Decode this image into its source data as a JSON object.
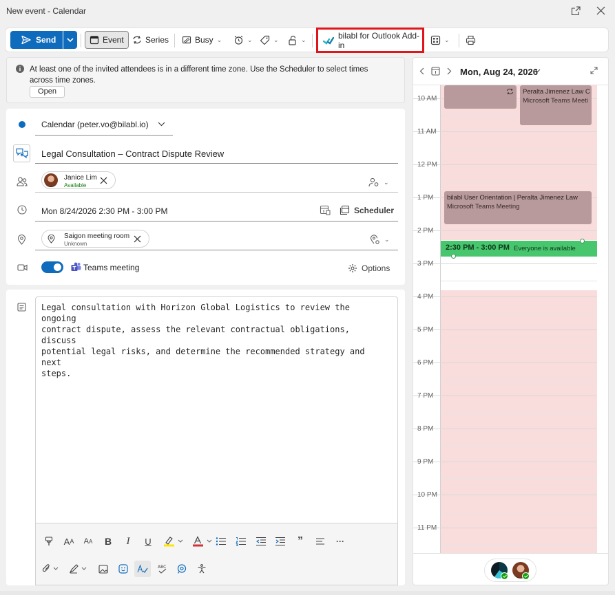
{
  "window": {
    "title": "New event - Calendar"
  },
  "toolbar": {
    "send_label": "Send",
    "event_label": "Event",
    "series_label": "Series",
    "busy_label": "Busy",
    "addin_label": "bilabl for Outlook Add-in"
  },
  "infobar": {
    "message": "At least one of the invited attendees is in a different time zone. Use the Scheduler to select times across time zones.",
    "open_label": "Open"
  },
  "form": {
    "calendar_value": "Calendar (peter.vo@bilabl.io)",
    "title_value": "Legal Consultation – Contract Dispute Review",
    "attendee": {
      "name": "Janice Lim",
      "status": "Available"
    },
    "datetime_value": "Mon 8/24/2026 2:30 PM - 3:00 PM",
    "scheduler_label": "Scheduler",
    "location": {
      "name": "Saigon meeting room",
      "status": "Unknown"
    },
    "teams_label": "Teams meeting",
    "teams_enabled": true,
    "options_label": "Options"
  },
  "body": {
    "text": "Legal consultation with Horizon Global Logistics to review the ongoing\ncontract dispute, assess the relevant contractual obligations, discuss\npotential legal risks, and determine the recommended strategy and next\nsteps."
  },
  "calendar": {
    "date_label": "Mon, Aug 24, 2026",
    "hours": [
      "10 AM",
      "11 AM",
      "12 PM",
      "1 PM",
      "2 PM",
      "3 PM",
      "4 PM",
      "5 PM",
      "6 PM",
      "7 PM",
      "8 PM",
      "9 PM",
      "10 PM",
      "11 PM"
    ],
    "events": [
      {
        "title": "Peralta Jimenez Law C",
        "subtitle": "Microsoft Teams Meeti"
      },
      {
        "title": "bilabl User Orientation | Peralta Jimenez Law",
        "subtitle": "Microsoft Teams Meeting"
      }
    ],
    "selection": {
      "time": "2:30 PM - 3:00 PM",
      "status": "Everyone is available"
    }
  },
  "colors": {
    "accent": "#0f6cbd",
    "busy": "#f9dcdc",
    "event": "#b89a9c",
    "selection": "#47c66e",
    "highlight_border": "#e0141c"
  }
}
